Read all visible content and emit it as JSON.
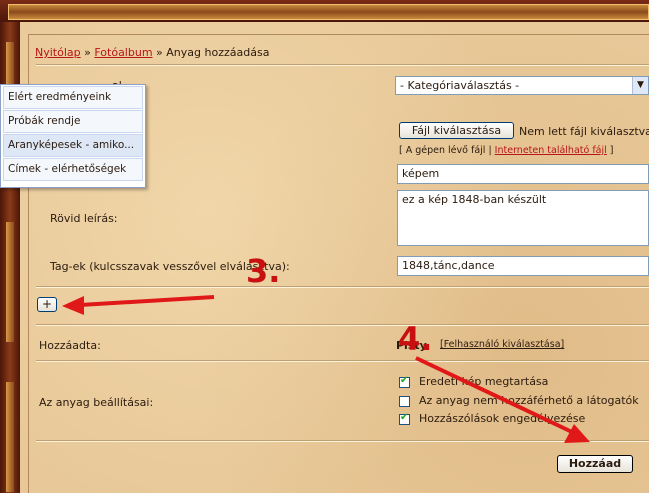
{
  "breadcrumb": {
    "home": "Nyitólap",
    "sep": "»",
    "album": "Fotóalbum",
    "current": "Anyag hozzáadása"
  },
  "category": {
    "label_partial": "al",
    "select_value": "- Kategóriaválasztás -"
  },
  "dropdown": {
    "items": [
      "Elért eredményeink",
      "Próbák rendje",
      "Aranyképesek - amiko...",
      "Címek - elérhetőségek"
    ]
  },
  "file": {
    "button": "Fájl kiválasztása",
    "status": "Nem lett fájl kiválasztva",
    "link_lead": "[ A gépen lévő fájl | ",
    "link_web": "Interneten található fájl",
    "link_tail": " ]"
  },
  "title_value": "képem",
  "description": {
    "label": "Rövid leírás:",
    "value": "ez a kép 1848-ban készült"
  },
  "tags": {
    "label": "Tag-ek (kulcsszavak vesszővel elválasztva):",
    "value": "1848,tánc,dance"
  },
  "add_button": "+",
  "added_by": {
    "label": "Hozzáadta:",
    "user": "Pisty",
    "link": "[Felhasználó kiválasztása]"
  },
  "settings": {
    "label": "Az anyag beállításai:",
    "options": [
      {
        "text": "Eredeti kép megtartása",
        "checked": true
      },
      {
        "text": "Az anyag nem hozzáférhető a látogatók",
        "checked": false
      },
      {
        "text": "Hozzászólások engedélyezése",
        "checked": true
      }
    ]
  },
  "submit": "Hozzáad",
  "annotations": {
    "step3": "3.",
    "step4": "4."
  },
  "colors": {
    "accent": "#b8161a",
    "arrow": "#e01818"
  }
}
